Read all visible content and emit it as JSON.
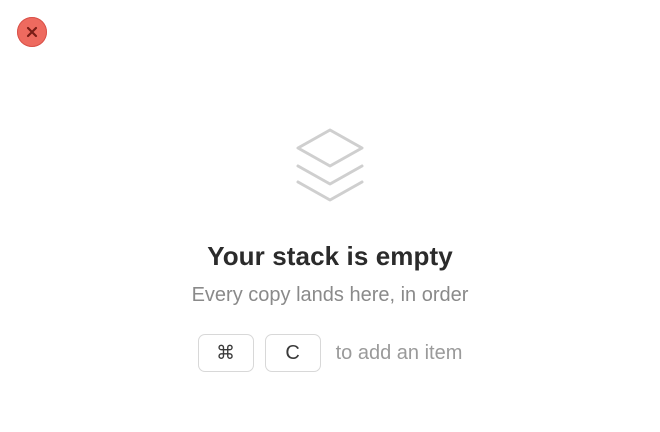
{
  "window": {
    "close_icon": "close-x-icon",
    "close_color": "#ee6a5f"
  },
  "empty_state": {
    "icon": "layers-stack-icon",
    "title": "Your stack is empty",
    "subtitle": "Every copy lands here, in order",
    "shortcut": {
      "keys": [
        "⌘",
        "C"
      ],
      "hint": "to add an item"
    }
  }
}
